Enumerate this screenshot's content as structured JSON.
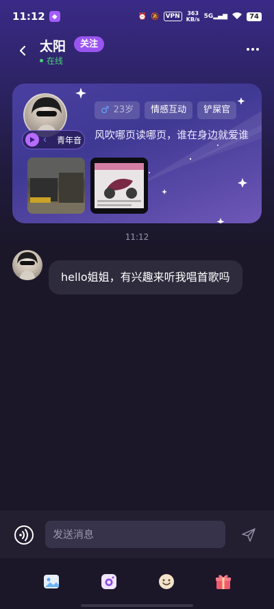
{
  "status_bar": {
    "time": "11:12",
    "network_speed_value": "363",
    "network_speed_unit": "KB/s",
    "vpn": "VPN",
    "cellular": "5G",
    "battery": "74"
  },
  "header": {
    "name": "太阳",
    "follow_label": "关注",
    "status": "在线"
  },
  "profile_card": {
    "voice_label": "青年音",
    "age": "23岁",
    "tags": [
      "情感互动",
      "铲屎官"
    ],
    "bio": "风吹哪页读哪页，谁在身边就爱谁"
  },
  "chat": {
    "timestamp": "11:12",
    "messages": [
      {
        "text": "hello姐姐，有兴趣来听我唱首歌吗"
      }
    ]
  },
  "input": {
    "placeholder": "发送消息"
  },
  "colors": {
    "accent": "#9a55f0",
    "online": "#4cd27a",
    "background": "#1b1729"
  }
}
